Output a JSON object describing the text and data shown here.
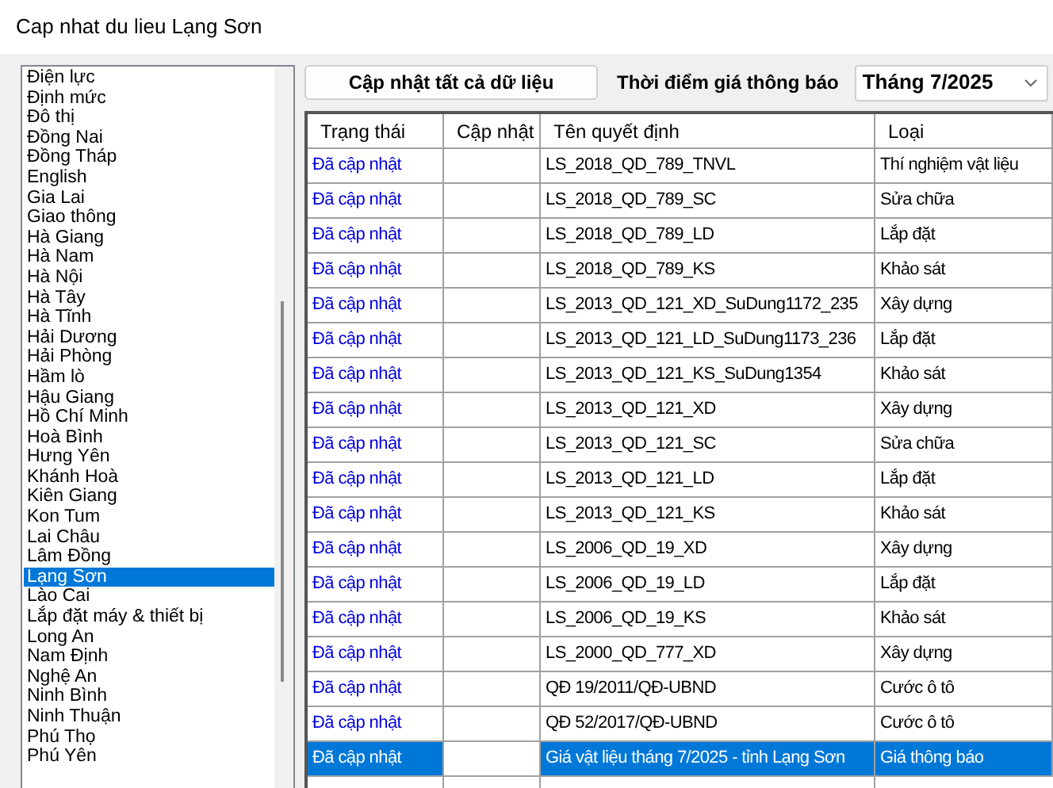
{
  "window": {
    "title": "Cap nhat du lieu Lạng Sơn"
  },
  "provinces": [
    {
      "label": "Điện lực",
      "selected": false
    },
    {
      "label": "Định mức",
      "selected": false
    },
    {
      "label": "Đô thị",
      "selected": false
    },
    {
      "label": "Đồng Nai",
      "selected": false
    },
    {
      "label": "Đồng Tháp",
      "selected": false
    },
    {
      "label": "English",
      "selected": false
    },
    {
      "label": "Gia Lai",
      "selected": false
    },
    {
      "label": "Giao thông",
      "selected": false
    },
    {
      "label": "Hà Giang",
      "selected": false
    },
    {
      "label": "Hà Nam",
      "selected": false
    },
    {
      "label": "Hà Nội",
      "selected": false
    },
    {
      "label": "Hà Tây",
      "selected": false
    },
    {
      "label": "Hà Tĩnh",
      "selected": false
    },
    {
      "label": "Hải Dương",
      "selected": false
    },
    {
      "label": "Hải Phòng",
      "selected": false
    },
    {
      "label": "Hầm lò",
      "selected": false
    },
    {
      "label": "Hậu Giang",
      "selected": false
    },
    {
      "label": "Hồ Chí Minh",
      "selected": false
    },
    {
      "label": "Hoà Bình",
      "selected": false
    },
    {
      "label": "Hưng Yên",
      "selected": false
    },
    {
      "label": "Khánh Hoà",
      "selected": false
    },
    {
      "label": "Kiên Giang",
      "selected": false
    },
    {
      "label": "Kon Tum",
      "selected": false
    },
    {
      "label": "Lai Châu",
      "selected": false
    },
    {
      "label": "Lâm Đồng",
      "selected": false
    },
    {
      "label": "Lạng Sơn",
      "selected": true
    },
    {
      "label": "Lào Cai",
      "selected": false
    },
    {
      "label": "Lắp đặt máy & thiết bị",
      "selected": false
    },
    {
      "label": "Long An",
      "selected": false
    },
    {
      "label": "Nam Định",
      "selected": false
    },
    {
      "label": "Nghệ An",
      "selected": false
    },
    {
      "label": "Ninh Bình",
      "selected": false
    },
    {
      "label": "Ninh Thuận",
      "selected": false
    },
    {
      "label": "Phú Thọ",
      "selected": false
    },
    {
      "label": "Phú Yên",
      "selected": false
    }
  ],
  "update_all_button": "Cập nhật tất cả dữ liệu",
  "price_time": {
    "label": "Thời điểm giá thông báo",
    "value": "Tháng 7/2025"
  },
  "table": {
    "columns": [
      "Trạng thái",
      "Cập nhật",
      "Tên quyết định",
      "Loại"
    ],
    "rows": [
      {
        "status": "Đã cập nhật",
        "name": "LS_2018_QD_789_TNVL",
        "type": "Thí nghiệm vật liệu",
        "selected": false
      },
      {
        "status": "Đã cập nhật",
        "name": "LS_2018_QD_789_SC",
        "type": "Sửa chữa",
        "selected": false
      },
      {
        "status": "Đã cập nhật",
        "name": "LS_2018_QD_789_LD",
        "type": "Lắp đặt",
        "selected": false
      },
      {
        "status": "Đã cập nhật",
        "name": "LS_2018_QD_789_KS",
        "type": "Khảo sát",
        "selected": false
      },
      {
        "status": "Đã cập nhật",
        "name": "LS_2013_QD_121_XD_SuDung1172_235",
        "type": "Xây dựng",
        "selected": false
      },
      {
        "status": "Đã cập nhật",
        "name": "LS_2013_QD_121_LD_SuDung1173_236",
        "type": "Lắp đặt",
        "selected": false
      },
      {
        "status": "Đã cập nhật",
        "name": "LS_2013_QD_121_KS_SuDung1354",
        "type": "Khảo sát",
        "selected": false
      },
      {
        "status": "Đã cập nhật",
        "name": "LS_2013_QD_121_XD",
        "type": "Xây dựng",
        "selected": false
      },
      {
        "status": "Đã cập nhật",
        "name": "LS_2013_QD_121_SC",
        "type": "Sửa chữa",
        "selected": false
      },
      {
        "status": "Đã cập nhật",
        "name": "LS_2013_QD_121_LD",
        "type": "Lắp đặt",
        "selected": false
      },
      {
        "status": "Đã cập nhật",
        "name": "LS_2013_QD_121_KS",
        "type": "Khảo sát",
        "selected": false
      },
      {
        "status": "Đã cập nhật",
        "name": "LS_2006_QD_19_XD",
        "type": "Xây dựng",
        "selected": false
      },
      {
        "status": "Đã cập nhật",
        "name": "LS_2006_QD_19_LD",
        "type": "Lắp đặt",
        "selected": false
      },
      {
        "status": "Đã cập nhật",
        "name": "LS_2006_QD_19_KS",
        "type": "Khảo sát",
        "selected": false
      },
      {
        "status": "Đã cập nhật",
        "name": "LS_2000_QD_777_XD",
        "type": "Xây dựng",
        "selected": false
      },
      {
        "status": "Đã cập nhật",
        "name": "QĐ 19/2011/QĐ-UBND",
        "type": "Cước ô tô",
        "selected": false
      },
      {
        "status": "Đã cập nhật",
        "name": "QĐ 52/2017/QĐ-UBND",
        "type": "Cước ô tô",
        "selected": false
      },
      {
        "status": "Đã cập nhật",
        "name": "Giá vật liệu tháng 7/2025 - tỉnh Lạng Sơn",
        "type": "Giá thông báo",
        "selected": true
      }
    ]
  }
}
